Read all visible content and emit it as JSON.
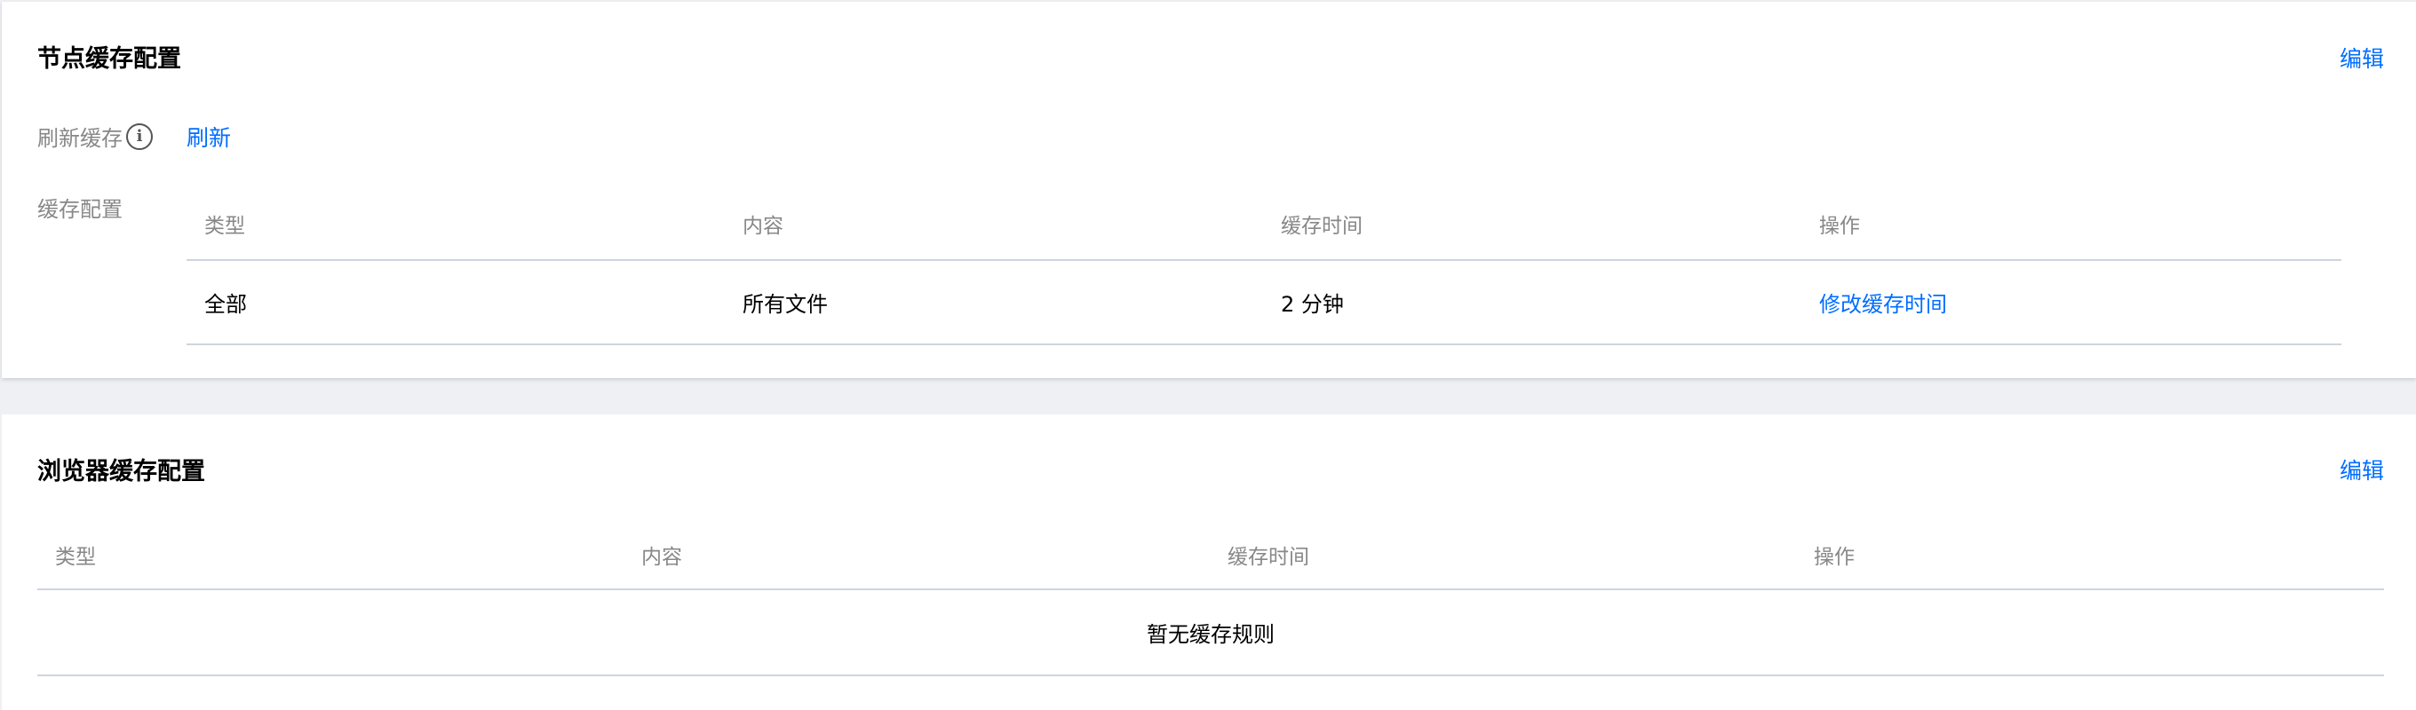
{
  "node_cache": {
    "title": "节点缓存配置",
    "edit_label": "编辑",
    "refresh": {
      "label": "刷新缓存",
      "action_label": "刷新"
    },
    "config_label": "缓存配置",
    "table": {
      "columns": [
        "类型",
        "内容",
        "缓存时间",
        "操作"
      ],
      "rows": [
        {
          "type": "全部",
          "content": "所有文件",
          "cache_time": "2 分钟",
          "action": "修改缓存时间"
        }
      ]
    }
  },
  "browser_cache": {
    "title": "浏览器缓存配置",
    "edit_label": "编辑",
    "table": {
      "columns": [
        "类型",
        "内容",
        "缓存时间",
        "操作"
      ],
      "empty_text": "暂无缓存规则"
    }
  },
  "colors": {
    "link": "#006eff",
    "label_gray": "#888888",
    "background": "#eef0f4",
    "border": "#cfd5de"
  },
  "icons": [
    "info-icon"
  ]
}
